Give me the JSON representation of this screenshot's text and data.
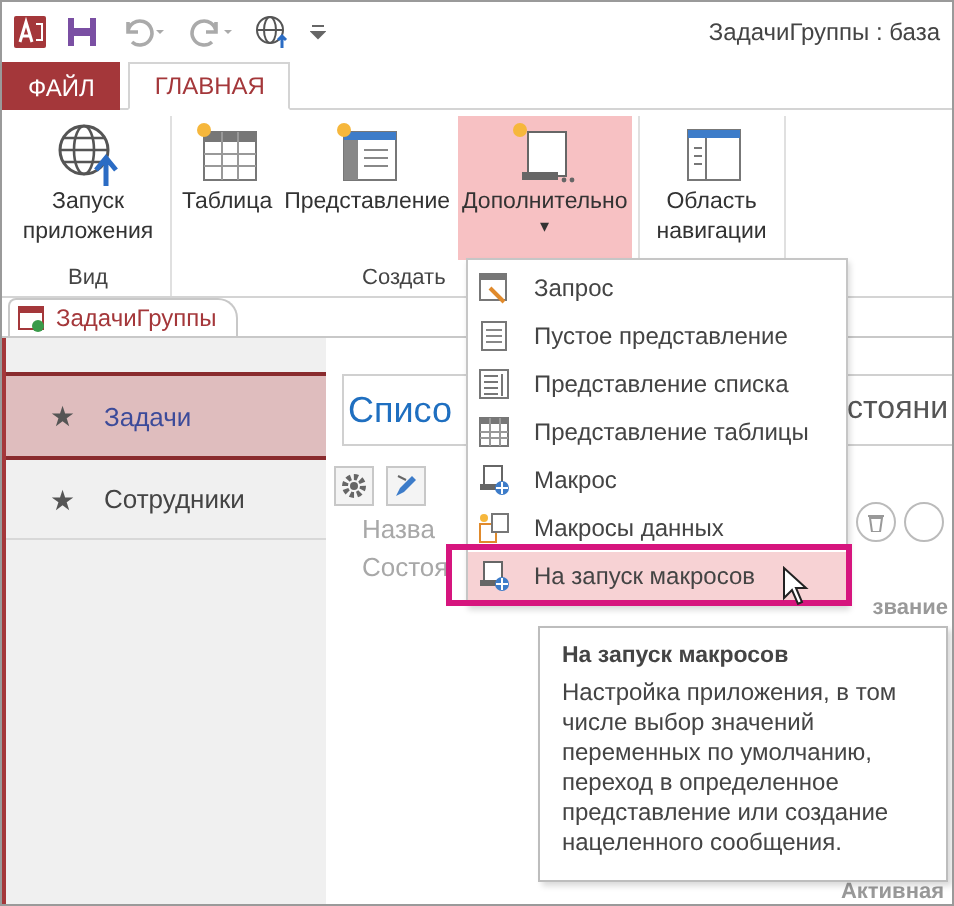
{
  "window": {
    "title": "ЗадачиГруппы : база"
  },
  "ribbon_tabs": [
    {
      "label": "ФАЙЛ",
      "kind": "file",
      "selected": false
    },
    {
      "label": "ГЛАВНАЯ",
      "kind": "tab",
      "selected": true
    }
  ],
  "ribbon_groups": [
    {
      "label": "Вид",
      "buttons": [
        {
          "label": "Запуск приложения",
          "kind": "launch",
          "highlighted": false
        }
      ]
    },
    {
      "label": "Создать",
      "buttons": [
        {
          "label": "Таблица",
          "kind": "table",
          "highlighted": false
        },
        {
          "label": "Представление",
          "kind": "view",
          "highlighted": false
        },
        {
          "label": "Дополнительно",
          "kind": "advanced",
          "highlighted": true,
          "dropdown": "▾"
        }
      ]
    },
    {
      "buttons": [
        {
          "label": "Область навигации",
          "kind": "navpane",
          "highlighted": false
        }
      ]
    }
  ],
  "document_tab": {
    "label": "ЗадачиГруппы"
  },
  "nav_items": [
    {
      "label": "Задачи",
      "icon": "★",
      "selected": true
    },
    {
      "label": "Сотрудники",
      "icon": "★",
      "selected": false
    }
  ],
  "view": {
    "title_left": "Списо",
    "title_right": "стояни",
    "field_labels": [
      "Назва",
      "Состоя"
    ],
    "caption": "звание",
    "status": "Активная"
  },
  "menu": [
    {
      "label": "Запрос",
      "kind": "query",
      "selected": false
    },
    {
      "label": "Пустое представление",
      "kind": "blank",
      "selected": false
    },
    {
      "label": "Представление списка",
      "kind": "list",
      "selected": false
    },
    {
      "label": "Представление таблицы",
      "kind": "datasheet",
      "selected": false
    },
    {
      "label": "Макрос",
      "kind": "macro",
      "selected": false
    },
    {
      "label": "Макросы данных",
      "kind": "datamacro",
      "selected": false
    },
    {
      "label": "На запуск макросов",
      "kind": "macro",
      "selected": true
    }
  ],
  "tooltip": {
    "title": "На запуск макросов",
    "text": "Настройка приложения, в том числе выбор значений переменных по умолчанию, переход в определенное представление или создание нацеленного сообщения."
  }
}
